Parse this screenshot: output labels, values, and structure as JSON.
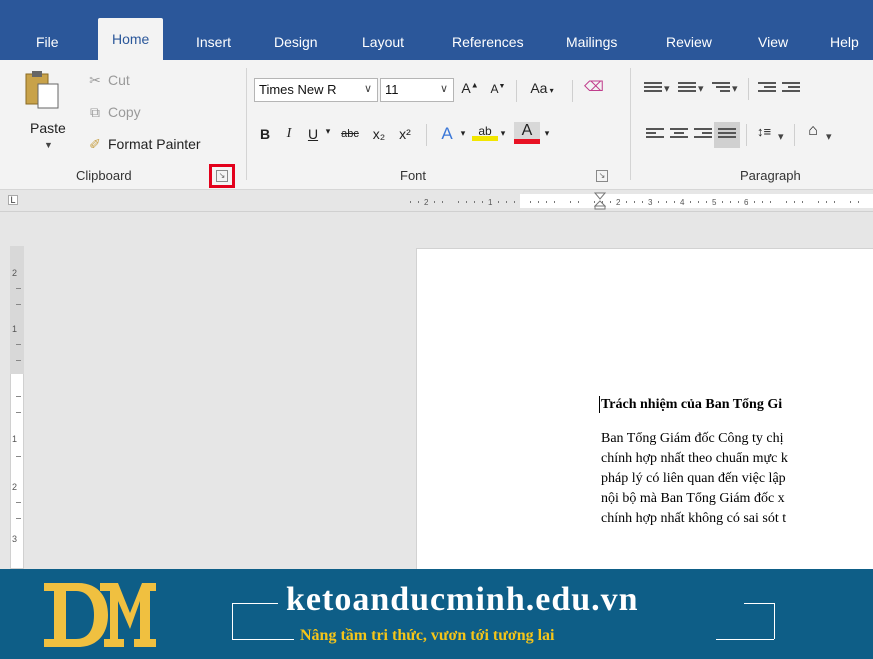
{
  "tabs": [
    "File",
    "Home",
    "Insert",
    "Design",
    "Layout",
    "References",
    "Mailings",
    "Review",
    "View",
    "Help"
  ],
  "clipboard": {
    "paste": "Paste",
    "cut": "Cut",
    "copy": "Copy",
    "format_painter": "Format Painter",
    "group_label": "Clipboard",
    "launcher_highlight_color": "#e3001b"
  },
  "font": {
    "name": "Times New R",
    "size": "11",
    "change_case": "Aa",
    "bold": "B",
    "italic": "I",
    "underline": "U",
    "strikethrough": "abc",
    "subscript": "x₂",
    "superscript": "x²",
    "group_label": "Font",
    "highlight_color": "#f2e600",
    "font_color": "#e81123"
  },
  "paragraph": {
    "group_label": "Paragraph"
  },
  "ruler": {
    "corner": "L",
    "vertical_numbers": [
      "2",
      "1",
      "1",
      "2",
      "3"
    ]
  },
  "document": {
    "heading": "Trách nhiệm của Ban Tổng Gi",
    "lines": [
      "Ban Tổng Giám đốc Công ty chị",
      "chính hợp nhất theo chuẩn mực k",
      "pháp lý có liên quan đến việc lập",
      "nội bộ mà Ban Tổng Giám đốc x",
      "chính hợp nhất không có sai sót t"
    ]
  },
  "banner": {
    "site": "ketoanducminh.edu.vn",
    "tagline": "Nâng tầm tri thức, vươn tới tương lai",
    "colors": {
      "background": "#0e5e87",
      "accent": "#f5c518"
    }
  },
  "theme": {
    "ribbon_tab_blue": "#2b579a",
    "ribbon_bg": "#f3f3f3"
  }
}
